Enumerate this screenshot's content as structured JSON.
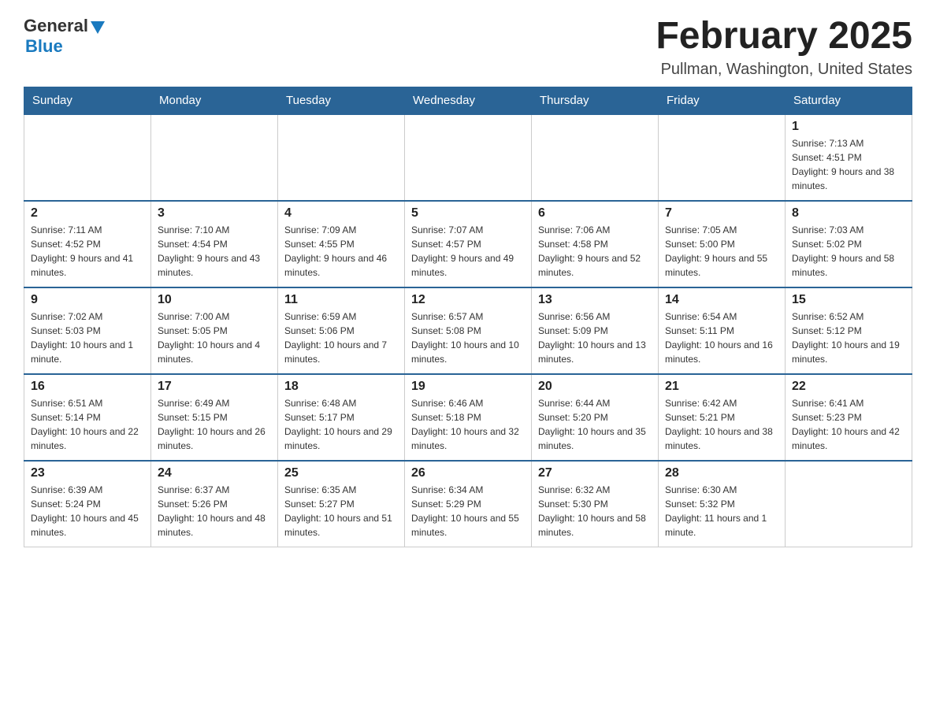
{
  "header": {
    "logo_general": "General",
    "logo_blue": "Blue",
    "month_title": "February 2025",
    "location": "Pullman, Washington, United States"
  },
  "weekdays": [
    "Sunday",
    "Monday",
    "Tuesday",
    "Wednesday",
    "Thursday",
    "Friday",
    "Saturday"
  ],
  "weeks": [
    {
      "days": [
        {
          "number": "",
          "info": ""
        },
        {
          "number": "",
          "info": ""
        },
        {
          "number": "",
          "info": ""
        },
        {
          "number": "",
          "info": ""
        },
        {
          "number": "",
          "info": ""
        },
        {
          "number": "",
          "info": ""
        },
        {
          "number": "1",
          "info": "Sunrise: 7:13 AM\nSunset: 4:51 PM\nDaylight: 9 hours and 38 minutes."
        }
      ]
    },
    {
      "days": [
        {
          "number": "2",
          "info": "Sunrise: 7:11 AM\nSunset: 4:52 PM\nDaylight: 9 hours and 41 minutes."
        },
        {
          "number": "3",
          "info": "Sunrise: 7:10 AM\nSunset: 4:54 PM\nDaylight: 9 hours and 43 minutes."
        },
        {
          "number": "4",
          "info": "Sunrise: 7:09 AM\nSunset: 4:55 PM\nDaylight: 9 hours and 46 minutes."
        },
        {
          "number": "5",
          "info": "Sunrise: 7:07 AM\nSunset: 4:57 PM\nDaylight: 9 hours and 49 minutes."
        },
        {
          "number": "6",
          "info": "Sunrise: 7:06 AM\nSunset: 4:58 PM\nDaylight: 9 hours and 52 minutes."
        },
        {
          "number": "7",
          "info": "Sunrise: 7:05 AM\nSunset: 5:00 PM\nDaylight: 9 hours and 55 minutes."
        },
        {
          "number": "8",
          "info": "Sunrise: 7:03 AM\nSunset: 5:02 PM\nDaylight: 9 hours and 58 minutes."
        }
      ]
    },
    {
      "days": [
        {
          "number": "9",
          "info": "Sunrise: 7:02 AM\nSunset: 5:03 PM\nDaylight: 10 hours and 1 minute."
        },
        {
          "number": "10",
          "info": "Sunrise: 7:00 AM\nSunset: 5:05 PM\nDaylight: 10 hours and 4 minutes."
        },
        {
          "number": "11",
          "info": "Sunrise: 6:59 AM\nSunset: 5:06 PM\nDaylight: 10 hours and 7 minutes."
        },
        {
          "number": "12",
          "info": "Sunrise: 6:57 AM\nSunset: 5:08 PM\nDaylight: 10 hours and 10 minutes."
        },
        {
          "number": "13",
          "info": "Sunrise: 6:56 AM\nSunset: 5:09 PM\nDaylight: 10 hours and 13 minutes."
        },
        {
          "number": "14",
          "info": "Sunrise: 6:54 AM\nSunset: 5:11 PM\nDaylight: 10 hours and 16 minutes."
        },
        {
          "number": "15",
          "info": "Sunrise: 6:52 AM\nSunset: 5:12 PM\nDaylight: 10 hours and 19 minutes."
        }
      ]
    },
    {
      "days": [
        {
          "number": "16",
          "info": "Sunrise: 6:51 AM\nSunset: 5:14 PM\nDaylight: 10 hours and 22 minutes."
        },
        {
          "number": "17",
          "info": "Sunrise: 6:49 AM\nSunset: 5:15 PM\nDaylight: 10 hours and 26 minutes."
        },
        {
          "number": "18",
          "info": "Sunrise: 6:48 AM\nSunset: 5:17 PM\nDaylight: 10 hours and 29 minutes."
        },
        {
          "number": "19",
          "info": "Sunrise: 6:46 AM\nSunset: 5:18 PM\nDaylight: 10 hours and 32 minutes."
        },
        {
          "number": "20",
          "info": "Sunrise: 6:44 AM\nSunset: 5:20 PM\nDaylight: 10 hours and 35 minutes."
        },
        {
          "number": "21",
          "info": "Sunrise: 6:42 AM\nSunset: 5:21 PM\nDaylight: 10 hours and 38 minutes."
        },
        {
          "number": "22",
          "info": "Sunrise: 6:41 AM\nSunset: 5:23 PM\nDaylight: 10 hours and 42 minutes."
        }
      ]
    },
    {
      "days": [
        {
          "number": "23",
          "info": "Sunrise: 6:39 AM\nSunset: 5:24 PM\nDaylight: 10 hours and 45 minutes."
        },
        {
          "number": "24",
          "info": "Sunrise: 6:37 AM\nSunset: 5:26 PM\nDaylight: 10 hours and 48 minutes."
        },
        {
          "number": "25",
          "info": "Sunrise: 6:35 AM\nSunset: 5:27 PM\nDaylight: 10 hours and 51 minutes."
        },
        {
          "number": "26",
          "info": "Sunrise: 6:34 AM\nSunset: 5:29 PM\nDaylight: 10 hours and 55 minutes."
        },
        {
          "number": "27",
          "info": "Sunrise: 6:32 AM\nSunset: 5:30 PM\nDaylight: 10 hours and 58 minutes."
        },
        {
          "number": "28",
          "info": "Sunrise: 6:30 AM\nSunset: 5:32 PM\nDaylight: 11 hours and 1 minute."
        },
        {
          "number": "",
          "info": ""
        }
      ]
    }
  ]
}
